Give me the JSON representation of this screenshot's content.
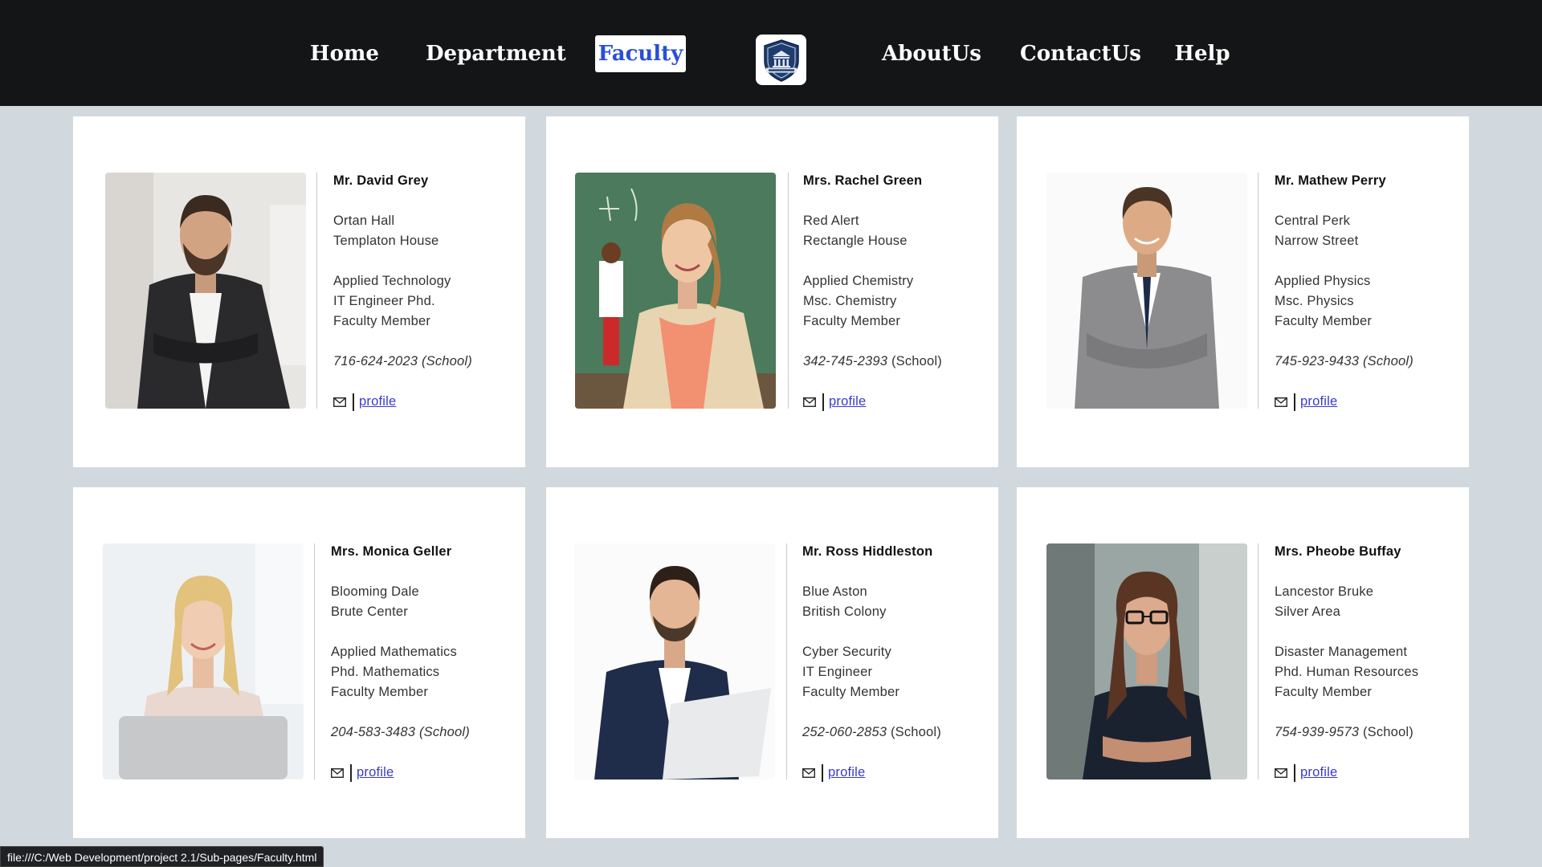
{
  "nav": {
    "items": [
      {
        "label": "Home"
      },
      {
        "label": "Department"
      },
      {
        "label": "Faculty",
        "active": true
      },
      {
        "label": "AboutUs"
      },
      {
        "label": "ContactUs"
      },
      {
        "label": "Help"
      }
    ],
    "logo_icon": "university-shield-icon"
  },
  "colors": {
    "nav_bg": "#141516",
    "page_bg": "#d1d8de",
    "active_text": "#2a4fd6",
    "link": "#3a3ad0"
  },
  "faculty": [
    {
      "name": "Mr. David Grey",
      "address1": "Ortan Hall",
      "address2": "Templaton House",
      "field": "Applied Technology",
      "degree": "IT Engineer Phd.",
      "role": "Faculty Member",
      "phone": "716-624-2023",
      "phone_suffix": "(School)",
      "profile_label": "profile"
    },
    {
      "name": "Mrs. Rachel Green",
      "address1": "Red Alert",
      "address2": "Rectangle House",
      "field": "Applied Chemistry",
      "degree": "Msc. Chemistry",
      "role": "Faculty Member",
      "phone": "342-745-2393",
      "phone_suffix": "(School)",
      "profile_label": "profile"
    },
    {
      "name": "Mr. Mathew Perry",
      "address1": "Central Perk",
      "address2": "Narrow Street",
      "field": "Applied Physics",
      "degree": "Msc. Physics",
      "role": "Faculty Member",
      "phone": "745-923-9433",
      "phone_suffix": "(School)",
      "profile_label": "profile"
    },
    {
      "name": "Mrs. Monica Geller",
      "address1": "Blooming Dale",
      "address2": "Brute Center",
      "field": "Applied Mathematics",
      "degree": "Phd. Mathematics",
      "role": "Faculty Member",
      "phone": "204-583-3483",
      "phone_suffix": "(School)",
      "profile_label": "profile"
    },
    {
      "name": "Mr. Ross Hiddleston",
      "address1": "Blue Aston",
      "address2": "British Colony",
      "field": "Cyber Security",
      "degree": "IT Engineer",
      "role": "Faculty Member",
      "phone": "252-060-2853",
      "phone_suffix": "(School)",
      "profile_label": "profile"
    },
    {
      "name": "Mrs. Pheobe Buffay",
      "address1": "Lancestor Bruke",
      "address2": "Silver Area",
      "field": "Disaster Management",
      "degree": "Phd. Human Resources",
      "role": "Faculty Member",
      "phone": "754-939-9573",
      "phone_suffix": "(School)",
      "profile_label": "profile"
    }
  ],
  "status_bar": {
    "url": "file:///C:/Web Development/project 2.1/Sub-pages/Faculty.html"
  }
}
